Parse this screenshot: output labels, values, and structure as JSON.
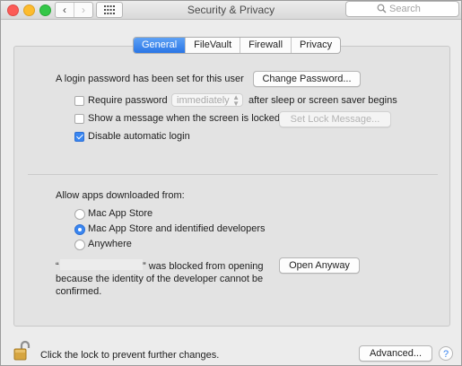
{
  "window": {
    "title": "Security & Privacy",
    "search_placeholder": "Search",
    "back_glyph": "‹",
    "forward_glyph": "›"
  },
  "tabs": [
    {
      "label": "General",
      "selected": true
    },
    {
      "label": "FileVault",
      "selected": false
    },
    {
      "label": "Firewall",
      "selected": false
    },
    {
      "label": "Privacy",
      "selected": false
    }
  ],
  "general": {
    "login_password_text": "A login password has been set for this user",
    "change_password_button": "Change Password...",
    "require_password_label": "Require password",
    "require_password_checked": false,
    "require_password_delay": "immediately",
    "after_sleep_text": "after sleep or screen saver begins",
    "show_message_label": "Show a message when the screen is locked",
    "show_message_checked": false,
    "set_lock_message_button": "Set Lock Message...",
    "disable_login_label": "Disable automatic login",
    "disable_login_checked": true,
    "allow_apps_label": "Allow apps downloaded from:",
    "allow_options": [
      {
        "label": "Mac App Store",
        "selected": false
      },
      {
        "label": "Mac App Store and identified developers",
        "selected": true
      },
      {
        "label": "Anywhere",
        "selected": false
      }
    ],
    "blocked_open_quote": "“",
    "blocked_text_1": "” was blocked from opening",
    "blocked_text_2": "because the identity of the developer cannot be",
    "blocked_text_3": "confirmed.",
    "open_anyway_button": "Open Anyway"
  },
  "footer": {
    "lock_text": "Click the lock to prevent further changes.",
    "advanced_button": "Advanced...",
    "help_glyph": "?"
  },
  "colors": {
    "accent": "#2a76e6",
    "window_bg": "#ececec",
    "panel_bg": "#e3e3e3"
  }
}
